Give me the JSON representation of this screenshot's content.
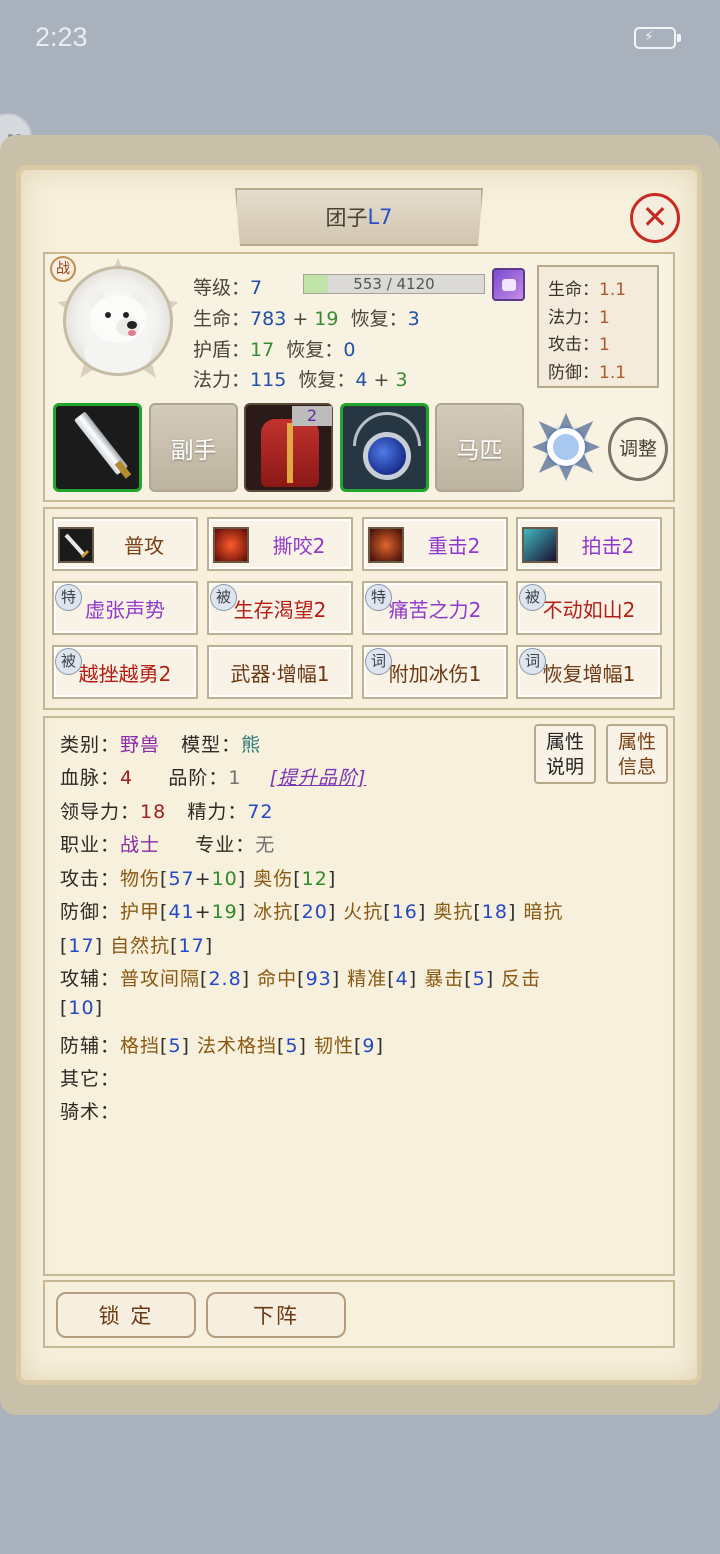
{
  "status_bar": {
    "time": "2:23",
    "battery_icon": "battery-charging-icon"
  },
  "title": {
    "name": "团子",
    "level": "L7"
  },
  "close_icon": "close-x-icon",
  "battle_badge": "战",
  "stats": {
    "level_label": "等级：",
    "level": "7",
    "exp_current": 553,
    "exp_max": 4120,
    "exp_text": "553 / 4120",
    "hp_label": "生命：",
    "hp_base": "783",
    "plus": "+",
    "hp_bonus": "19",
    "hp_regen_label": "恢复：",
    "hp_regen": "3",
    "shield_label": "护盾：",
    "shield": "17",
    "shield_regen_label": "恢复：",
    "shield_regen": "0",
    "mp_label": "法力：",
    "mp": "115",
    "mp_regen_label": "恢复：",
    "mp_regen_base": "4",
    "mp_regen_bonus": "3"
  },
  "ratios": [
    {
      "label": "生命：",
      "value": "1.1"
    },
    {
      "label": "法力：",
      "value": "1"
    },
    {
      "label": "攻击：",
      "value": "1"
    },
    {
      "label": "防御：",
      "value": "1.1"
    }
  ],
  "equipment": {
    "offhand_label": "副手",
    "armor_count": "2",
    "mount_label": "马匹",
    "adjust_label": "调整"
  },
  "skills": [
    {
      "label": "普攻",
      "tag": ""
    },
    {
      "label": "撕咬2",
      "tag": ""
    },
    {
      "label": "重击2",
      "tag": ""
    },
    {
      "label": "拍击2",
      "tag": ""
    },
    {
      "label": "虚张声势",
      "tag": "特"
    },
    {
      "label": "生存渴望2",
      "tag": "被"
    },
    {
      "label": "痛苦之力2",
      "tag": "特"
    },
    {
      "label": "不动如山2",
      "tag": "被"
    },
    {
      "label": "越挫越勇2",
      "tag": "被"
    },
    {
      "label": "武器·增幅1",
      "tag": ""
    },
    {
      "label": "附加冰伤1",
      "tag": "词"
    },
    {
      "label": "恢复增幅1",
      "tag": "词"
    }
  ],
  "details": {
    "category_label": "类别：",
    "category": "野兽",
    "model_label": "模型：",
    "model": "熊",
    "bloodline_label": "血脉：",
    "bloodline": "4",
    "grade_label": "品阶：",
    "grade": "1",
    "upgrade_link": "[提升品阶]",
    "leadership_label": "领导力：",
    "leadership": "18",
    "energy_label": "精力：",
    "energy": "72",
    "job_label": "职业：",
    "job": "战士",
    "specialty_label": "专业：",
    "specialty": "无",
    "attack_label": "攻击：",
    "phys_label": "物伤",
    "phys_base": "57",
    "phys_bonus": "10",
    "arcane_label": "奥伤",
    "arcane": "12",
    "defense_label": "防御：",
    "armor_label": "护甲",
    "armor_base": "41",
    "armor_bonus": "19",
    "ice_res_label": "冰抗",
    "ice_res": "20",
    "fire_res_label": "火抗",
    "fire_res": "16",
    "arcane_res_label": "奥抗",
    "arcane_res": "18",
    "dark_res_label": "暗抗",
    "dark_res": "17",
    "nature_res_label": "自然抗",
    "nature_res": "17",
    "atk_aux_label": "攻辅：",
    "interval_label": "普攻间隔",
    "interval": "2.8",
    "hit_label": "命中",
    "hit": "93",
    "precision_label": "精准",
    "precision": "4",
    "crit_label": "暴击",
    "crit": "5",
    "counter_label": "反击",
    "counter": "10",
    "def_aux_label": "防辅：",
    "block_label": "格挡",
    "block": "5",
    "spell_block_label": "法术格挡",
    "spell_block": "5",
    "toughness_label": "韧性",
    "toughness": "9",
    "other_label": "其它：",
    "riding_label": "骑术："
  },
  "attr_buttons": {
    "explain": [
      "属性",
      "说明"
    ],
    "info": [
      "属性",
      "信息"
    ]
  },
  "bottom_buttons": {
    "lock": "锁 定",
    "unformation": "下阵"
  }
}
